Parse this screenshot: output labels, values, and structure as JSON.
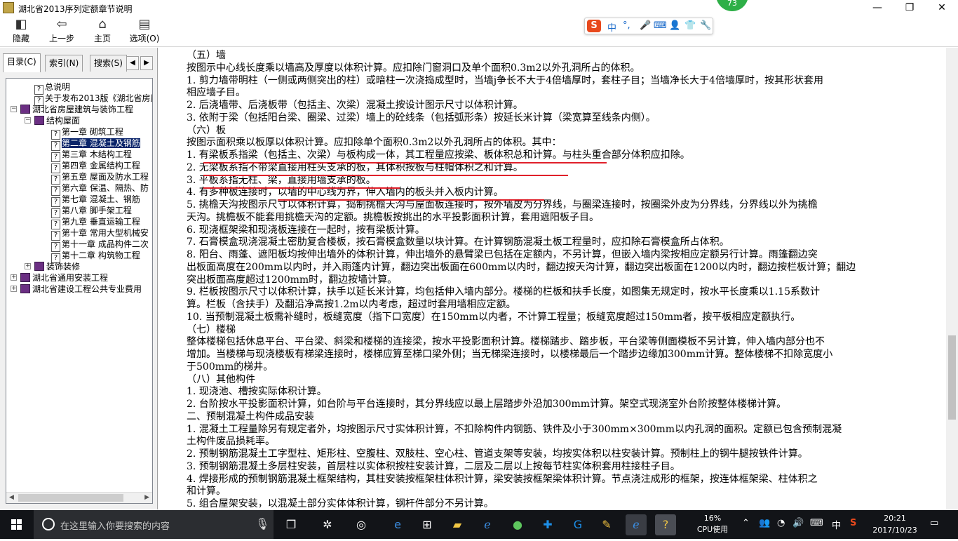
{
  "window": {
    "title": "湖北省2013序列定额章节说明",
    "minimize": "—",
    "maximize": "❐",
    "close": "✕"
  },
  "toolbar": {
    "hide_label": "隐藏",
    "back_label": "上一步",
    "home_label": "主页",
    "options_label": "选项(O)"
  },
  "ime": {
    "logo": "S",
    "lang": "中",
    "punct": "°,",
    "items": [
      "🎤",
      "⌨",
      "👤",
      "👕",
      "🔧"
    ]
  },
  "notify_badge": "73",
  "tabs": {
    "contents": "目录(C)",
    "index": "索引(N)",
    "search": "搜索(S)"
  },
  "tree": [
    {
      "label": "总说明",
      "level": 2,
      "icon": "q"
    },
    {
      "label": "关于发布2013版《湖北省房屋",
      "level": 2,
      "icon": "q"
    },
    {
      "label": "湖北省房屋建筑与装饰工程",
      "level": 1,
      "icon": "book",
      "expander": "−"
    },
    {
      "label": "结构屋面",
      "level": 2,
      "icon": "book",
      "expander": "−"
    },
    {
      "label": "第一章  砌筑工程",
      "level": 3,
      "icon": "q"
    },
    {
      "label": "第二章  混凝土及钢筋",
      "level": 3,
      "icon": "q",
      "selected": true
    },
    {
      "label": "第三章  木结构工程",
      "level": 3,
      "icon": "q"
    },
    {
      "label": "第四章  金属结构工程",
      "level": 3,
      "icon": "q"
    },
    {
      "label": "第五章  屋面及防水工程",
      "level": 3,
      "icon": "q"
    },
    {
      "label": "第六章  保温、隔热、防",
      "level": 3,
      "icon": "q"
    },
    {
      "label": "第七章  混凝土、钢筋",
      "level": 3,
      "icon": "q"
    },
    {
      "label": "第八章  脚手架工程",
      "level": 3,
      "icon": "q"
    },
    {
      "label": "第九章  垂直运输工程",
      "level": 3,
      "icon": "q"
    },
    {
      "label": "第十章  常用大型机械安",
      "level": 3,
      "icon": "q"
    },
    {
      "label": "第十一章  成品构件二次",
      "level": 3,
      "icon": "q"
    },
    {
      "label": "第十二章  构筑物工程",
      "level": 3,
      "icon": "q"
    },
    {
      "label": "装饰装修",
      "level": 2,
      "icon": "book",
      "expander": "+"
    },
    {
      "label": "湖北省通用安装工程",
      "level": 1,
      "icon": "book",
      "expander": "+"
    },
    {
      "label": "湖北省建设工程公共专业费用",
      "level": 1,
      "icon": "book",
      "expander": "+"
    }
  ],
  "content_lines": [
    "（五）墙",
    "按图示中心线长度乘以墙高及厚度以体积计算。应扣除门窗洞口及单个面积0.3m2以外孔洞所占的体积。",
    "1. 剪力墙带明柱（一侧或两侧突出的柱）或暗柱一次浇捣成型时，当墙j争长不大于4倍墙厚时，套柱子目；当墙净长大于4倍墙厚时，按其形状套用",
    "相应墙子目。",
    "2. 后浇墙带、后浇板带（包括主、次梁）混凝土按设计图示尺寸以体积计算。",
    "3. 依附于梁（包括阳台梁、圈梁、过梁）墙上的砼线条（包括弧形条）按延长米计算（梁宽算至线条内侧）。",
    "（六）板",
    "按图示面积乘以板厚以体积计算。应扣除单个面积0.3m2以外孔洞所占的体积。其中：",
    "1. 有梁板系指梁（包括主、次梁）与板构成一体，其工程量应按梁、板体积总和计算。与柱头重合部分体积应扣除。",
    "2. 无梁板系指不带梁直接用柱头支承的板，其体积按板与柱帽体积之和计算。",
    "3. 平板系指无柱、梁，直接用墙支承的板。",
    "4. 有多种板连接时，以墙的中心线为界，伸入墙内的板头并入板内计算。",
    "5. 挑檐天沟按图示尺寸以体积计算，捣制挑檐天沟与屋面板连接时，按外墙皮为分界线，与圈梁连接时，按圈梁外皮为分界线，分界线以外为挑檐",
    "天沟。挑檐板不能套用挑檐天沟的定额。挑檐板按挑出的水平投影面积计算，套用遮阳板子目。",
    "6. 现浇框架梁和现浇板连接在一起时，按有梁板计算。",
    "7. 石膏模盒现浇混凝土密肋复合楼板，按石膏模盒数量以块计算。在计算钢筋混凝土板工程量时，应扣除石膏模盒所占体积。",
    "8. 阳台、雨蓬、遮阳板均按伸出墙外的体积计算，伸出墙外的悬臂梁已包括在定额内，不另计算，但嵌入墙内梁按相应定额另行计算。雨篷翻边突",
    "出板面高度在200mm以内时，并入雨篷内计算，翻边突出板面在600mm以内时，翻边按天沟计算，翻边突出板面在1200以内时，翻边按栏板计算；翻边",
    "突出板面高度超过1200mm时，翻边按墙计算。",
    "9. 栏板按图示尺寸以体积计算，扶手以延长米计算，均包括伸入墙内部分。楼梯的栏板和扶手长度，如图集无规定时，按水平长度乘以1.15系数计",
    "算。栏板（含扶手）及翻沿净高按1.2m以内考虑，超过时套用墙相应定额。",
    "10. 当预制混凝土板需补缝时，板缝宽度（指下口宽度）在150mm以内者，不计算工程量；板缝宽度超过150mm者，按平板相应定额执行。",
    "（七）楼梯",
    "整体楼梯包括休息平台、平台梁、斜梁和楼梯的连接梁，按水平投影面积计算。楼梯踏步、踏步板，平台梁等侧面模板不另计算，伸入墙内部分也不",
    "增加。当楼梯与现浇楼板有梯梁连接时，楼梯应算至梯口梁外侧；当无梯梁连接时，以楼梯最后一个踏步边缘加300mm计算。整体楼梯不扣除宽度小",
    "于500mm的梯井。",
    "（八）其他构件",
    "1. 现浇池、槽按实际体积计算。",
    "2. 台阶按水平投影面积计算，如台阶与平台连接时，其分界线应以最上层踏步外沿加300mm计算。架空式现浇室外台阶按整体楼梯计算。",
    "二、预制混凝土构件成品安装",
    "1. 混凝土工程量除另有规定者外，均按图示尺寸实体积计算，不扣除构件内钢筋、铁件及小于300mm×300mm以内孔洞的面积。定额已包含预制混凝",
    "土构件废品损耗率。",
    "2. 预制钢筋混凝土工字型柱、矩形柱、空腹柱、双肢柱、空心柱、管道支架等安装，均按实体积以柱安装计算。预制柱上的钢牛腿按铁件计算。",
    "3. 预制钢筋混凝土多层柱安装，首层柱以实体积按柱安装计算，二层及二层以上按每节柱实体积套用柱接柱子目。",
    "4. 焊接形成的预制钢筋混凝土框架结构，其柱安装按框架柱体积计算，梁安装按框架梁体积计算。节点浇注成形的框架，按连体框架梁、柱体积之",
    "和计算。",
    "5. 组合屋架安装，以混凝土部分实体体积计算，钢杆件部分不另计算。"
  ],
  "taskbar": {
    "search_placeholder": "在这里输入你要搜索的内容",
    "cpu_percent": "16%",
    "cpu_label": "CPU使用",
    "ime_lang": "中",
    "time": "20:21",
    "date": "2017/10/23"
  }
}
